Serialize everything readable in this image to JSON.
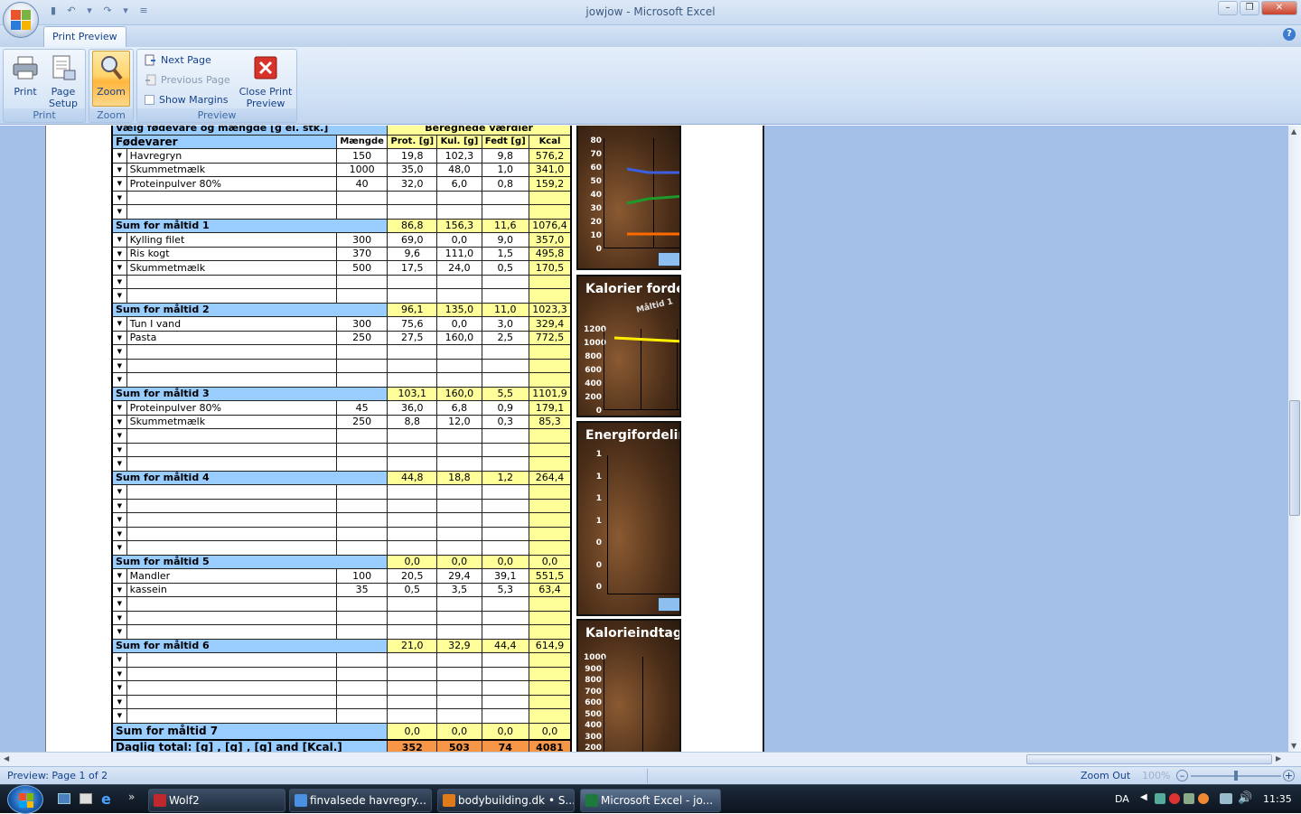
{
  "window": {
    "title": "jowjow - Microsoft Excel"
  },
  "quick_access": {
    "save_icon": "save-icon",
    "undo_icon": "undo-icon",
    "redo_icon": "redo-icon"
  },
  "ribbon": {
    "tab": "Print Preview",
    "groups": {
      "print": {
        "label": "Print",
        "print_btn": "Print",
        "page_setup_btn": "Page Setup"
      },
      "zoom": {
        "label": "Zoom",
        "zoom_btn": "Zoom"
      },
      "preview": {
        "label": "Preview",
        "next_page": "Next Page",
        "previous_page": "Previous Page",
        "show_margins": "Show Margins",
        "close": "Close Print Preview"
      }
    }
  },
  "sheet": {
    "header_top": "Vælg fødevare og mængde [g el. stk.]",
    "header_top_right": "Beregnede værdier",
    "columns": {
      "food": "Fødevarer",
      "amount": "Mængde",
      "prot": "Prot. [g]",
      "kul": "Kul. [g]",
      "fedt": "Fedt [g]",
      "kcal": "Kcal"
    },
    "meals": [
      {
        "items": [
          [
            "Havregryn",
            "150",
            "19,8",
            "102,3",
            "9,8",
            "576,2"
          ],
          [
            "Skummetmælk",
            "1000",
            "35,0",
            "48,0",
            "1,0",
            "341,0"
          ],
          [
            "Proteinpulver 80%",
            "40",
            "32,0",
            "6,0",
            "0,8",
            "159,2"
          ],
          [
            "",
            "",
            "",
            "",
            "",
            ""
          ],
          [
            "",
            "",
            "",
            "",
            "",
            ""
          ]
        ],
        "sum": [
          "Sum for måltid 1",
          "86,8",
          "156,3",
          "11,6",
          "1076,4"
        ]
      },
      {
        "items": [
          [
            "Kylling filet",
            "300",
            "69,0",
            "0,0",
            "9,0",
            "357,0"
          ],
          [
            "Ris kogt",
            "370",
            "9,6",
            "111,0",
            "1,5",
            "495,8"
          ],
          [
            "Skummetmælk",
            "500",
            "17,5",
            "24,0",
            "0,5",
            "170,5"
          ],
          [
            "",
            "",
            "",
            "",
            "",
            ""
          ],
          [
            "",
            "",
            "",
            "",
            "",
            ""
          ]
        ],
        "sum": [
          "Sum for måltid 2",
          "96,1",
          "135,0",
          "11,0",
          "1023,3"
        ]
      },
      {
        "items": [
          [
            "Tun I vand",
            "300",
            "75,6",
            "0,0",
            "3,0",
            "329,4"
          ],
          [
            "Pasta",
            "250",
            "27,5",
            "160,0",
            "2,5",
            "772,5"
          ],
          [
            "",
            "",
            "",
            "",
            "",
            ""
          ],
          [
            "",
            "",
            "",
            "",
            "",
            ""
          ],
          [
            "",
            "",
            "",
            "",
            "",
            ""
          ]
        ],
        "sum": [
          "Sum for måltid 3",
          "103,1",
          "160,0",
          "5,5",
          "1101,9"
        ]
      },
      {
        "items": [
          [
            "Proteinpulver 80%",
            "45",
            "36,0",
            "6,8",
            "0,9",
            "179,1"
          ],
          [
            "Skummetmælk",
            "250",
            "8,8",
            "12,0",
            "0,3",
            "85,3"
          ],
          [
            "",
            "",
            "",
            "",
            "",
            ""
          ],
          [
            "",
            "",
            "",
            "",
            "",
            ""
          ],
          [
            "",
            "",
            "",
            "",
            "",
            ""
          ]
        ],
        "sum": [
          "Sum for måltid 4",
          "44,8",
          "18,8",
          "1,2",
          "264,4"
        ]
      },
      {
        "items": [
          [
            "",
            "",
            "",
            "",
            "",
            ""
          ],
          [
            "",
            "",
            "",
            "",
            "",
            ""
          ],
          [
            "",
            "",
            "",
            "",
            "",
            ""
          ],
          [
            "",
            "",
            "",
            "",
            "",
            ""
          ],
          [
            "",
            "",
            "",
            "",
            "",
            ""
          ]
        ],
        "sum": [
          "Sum for måltid 5",
          "0,0",
          "0,0",
          "0,0",
          "0,0"
        ]
      },
      {
        "items": [
          [
            "Mandler",
            "100",
            "20,5",
            "29,4",
            "39,1",
            "551,5"
          ],
          [
            "kassein",
            "35",
            "0,5",
            "3,5",
            "5,3",
            "63,4"
          ],
          [
            "",
            "",
            "",
            "",
            "",
            ""
          ],
          [
            "",
            "",
            "",
            "",
            "",
            ""
          ],
          [
            "",
            "",
            "",
            "",
            "",
            ""
          ]
        ],
        "sum": [
          "Sum for måltid 6",
          "21,0",
          "32,9",
          "44,4",
          "614,9"
        ]
      },
      {
        "items": [
          [
            "",
            "",
            "",
            "",
            "",
            ""
          ],
          [
            "",
            "",
            "",
            "",
            "",
            ""
          ],
          [
            "",
            "",
            "",
            "",
            "",
            ""
          ],
          [
            "",
            "",
            "",
            "",
            "",
            ""
          ],
          [
            "",
            "",
            "",
            "",
            "",
            ""
          ]
        ],
        "sum": [
          "Sum for måltid 7",
          "0,0",
          "0,0",
          "0,0",
          "0,0"
        ]
      }
    ],
    "total": [
      "Daglig total: [g] , [g] , [g] and [Kcal.]",
      "352",
      "503",
      "74",
      "4081"
    ]
  },
  "charts": {
    "c1": {
      "yticks": [
        "80",
        "70",
        "60",
        "50",
        "40",
        "30",
        "20",
        "10",
        "0"
      ]
    },
    "c2": {
      "title": "Kalorier forde",
      "subtitle": "Måltid 1",
      "yticks": [
        "1200",
        "1000",
        "800",
        "600",
        "400",
        "200",
        "0"
      ]
    },
    "c3": {
      "title": "Energifordelin",
      "yticks": [
        "1",
        "1",
        "1",
        "1",
        "0",
        "0",
        "0"
      ]
    },
    "c4": {
      "title": "Kalorieindtag e",
      "yticks": [
        "1000",
        "900",
        "800",
        "700",
        "600",
        "500",
        "400",
        "300",
        "200"
      ]
    }
  },
  "statusbar": {
    "text": "Preview: Page 1 of 2",
    "zoom_out": "Zoom Out",
    "zoom_level": "100%"
  },
  "taskbar": {
    "items": [
      {
        "label": "Wolf2",
        "color": "#c0282d"
      },
      {
        "label": "finvalsede havregry...",
        "color": "#4a8fe0"
      },
      {
        "label": "bodybuilding.dk • S...",
        "color": "#e07a1a"
      },
      {
        "label": "Microsoft Excel - jo...",
        "color": "#1e7a3c"
      }
    ],
    "lang": "DA",
    "clock": "11:35"
  }
}
